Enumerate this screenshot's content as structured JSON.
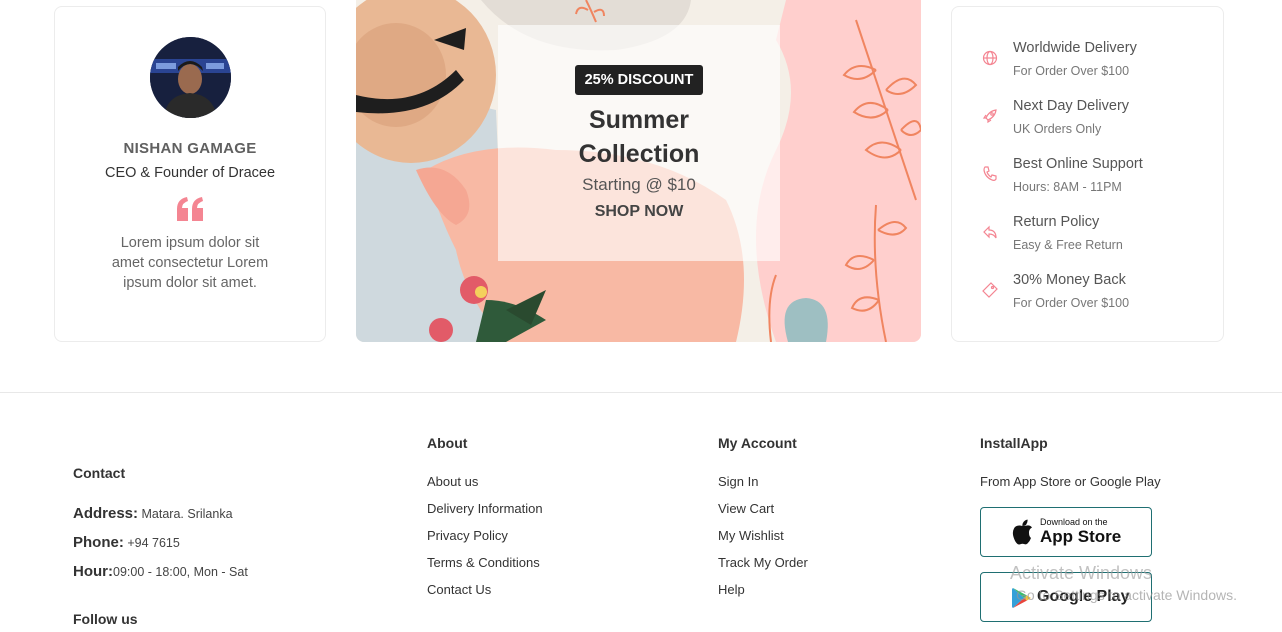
{
  "testimonial": {
    "name": "NISHAN GAMAGE",
    "role": "CEO & Founder of Dracee",
    "quote_icon": "quote-icon",
    "text": "Lorem ipsum dolor sit amet consectetur Lorem ipsum dolor sit amet.",
    "accent_color": "#f48592"
  },
  "banner": {
    "badge": "25% DISCOUNT",
    "title_line1": "Summer",
    "title_line2": "Collection",
    "subtitle": "Starting @ $10",
    "cta": "SHOP NOW"
  },
  "features": [
    {
      "icon": "globe-icon",
      "title": "Worldwide Delivery",
      "subtitle": "For Order Over $100"
    },
    {
      "icon": "rocket-icon",
      "title": "Next Day Delivery",
      "subtitle": "UK Orders Only"
    },
    {
      "icon": "phone-icon",
      "title": "Best Online Support",
      "subtitle": "Hours: 8AM - 11PM"
    },
    {
      "icon": "return-arrow-icon",
      "title": "Return Policy",
      "subtitle": "Easy & Free Return"
    },
    {
      "icon": "ticket-icon",
      "title": "30% Money Back",
      "subtitle": "For Order Over $100"
    }
  ],
  "footer": {
    "contact": {
      "heading": "Contact",
      "address_label": "Address:",
      "address_value": "Matara. Srilanka",
      "phone_label": "Phone:",
      "phone_value": "+94 7615",
      "hour_label": "Hour:",
      "hour_value": "09:00 - 18:00, Mon - Sat",
      "follow_heading": "Follow us"
    },
    "about": {
      "heading": "About",
      "links": [
        "About us",
        "Delivery Information",
        "Privacy Policy",
        "Terms & Conditions",
        "Contact Us"
      ]
    },
    "account": {
      "heading": "My Account",
      "links": [
        "Sign In",
        "View Cart",
        "My Wishlist",
        "Track My Order",
        "Help"
      ]
    },
    "install": {
      "heading": "InstallApp",
      "text": "From App Store or Google Play",
      "app_store_small": "Download on the",
      "app_store_big": "App Store",
      "google_play": "Google Play"
    }
  },
  "watermark": {
    "line1": "Activate Windows",
    "line2": "Go to Settings to activate Windows."
  },
  "colors": {
    "accent_pink": "#f48592",
    "button_border": "#1f6f72",
    "badge_bg": "#222222"
  }
}
